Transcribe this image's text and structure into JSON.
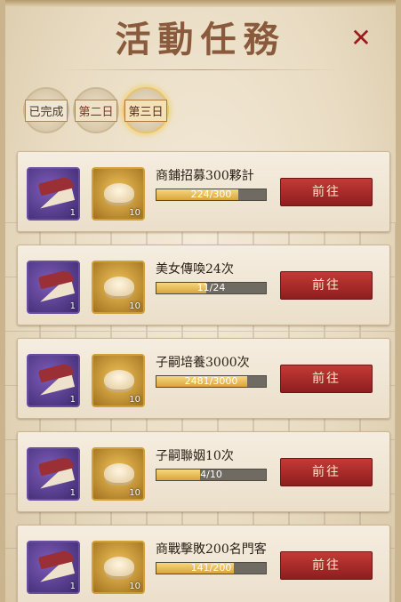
{
  "title": "活動任務",
  "tabs": [
    {
      "label": "已完成"
    },
    {
      "label": "第二日"
    },
    {
      "label": "第三日"
    }
  ],
  "tasks": [
    {
      "name": "商鋪招募300夥計",
      "progress_text": "224/300",
      "progress_fraction": 0.747,
      "reward1_qty": "1",
      "reward2_qty": "10",
      "button": "前往"
    },
    {
      "name": "美女傳喚24次",
      "progress_text": "11/24",
      "progress_fraction": 0.458,
      "reward1_qty": "1",
      "reward2_qty": "10",
      "button": "前往"
    },
    {
      "name": "子嗣培養3000次",
      "progress_text": "2481/3000",
      "progress_fraction": 0.827,
      "reward1_qty": "1",
      "reward2_qty": "10",
      "button": "前往"
    },
    {
      "name": "子嗣聯姻10次",
      "progress_text": "4/10",
      "progress_fraction": 0.4,
      "reward1_qty": "1",
      "reward2_qty": "10",
      "button": "前往"
    },
    {
      "name": "商戰擊敗200名門客",
      "progress_text": "141/200",
      "progress_fraction": 0.705,
      "reward1_qty": "1",
      "reward2_qty": "10",
      "button": "前往"
    }
  ],
  "icons": {
    "close": "close-icon",
    "reward1": "cake-icon",
    "reward2": "silver-ingot-icon"
  },
  "colors": {
    "title": "#8a5a3c",
    "button": "#a82a28",
    "close": "#9b1a1a"
  }
}
